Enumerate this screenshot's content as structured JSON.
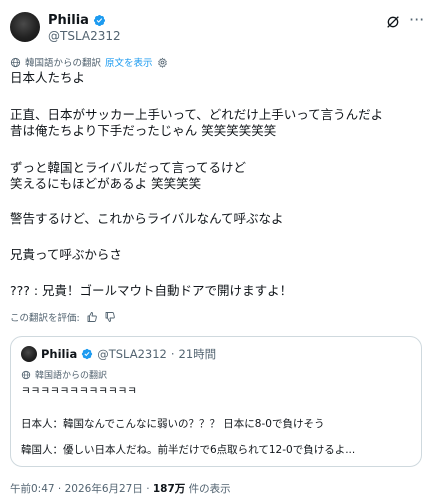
{
  "author": {
    "display_name": "Philia",
    "handle": "@TSLA2312"
  },
  "icons": {
    "verified": "verified-badge-icon",
    "grok": "grok-icon",
    "more": "more-options-icon",
    "globe": "globe-icon",
    "gear": "gear-icon",
    "thumb_up": "thumb-up-icon",
    "thumb_down": "thumb-down-icon"
  },
  "colors": {
    "accent": "#1d9bf0",
    "muted": "#536471",
    "text": "#0f1419",
    "border": "#cfd9de"
  },
  "translation_bar": {
    "label": "韓国語からの翻訳",
    "show_original": "原文を表示"
  },
  "post_lines": [
    "日本人たちよ",
    "正直、日本がサッカー上手いって、どれだけ上手いって言うんだよ",
    "昔は俺たちより下手だったじゃん 笑笑笑笑笑笑",
    "ずっと韓国とライバルだって言ってるけど",
    "笑えるにもほどがあるよ 笑笑笑笑",
    "警告するけど、これからライバルなんて呼ぶなよ",
    "兄貴って呼ぶからさ",
    "??? : 兄貴！ゴールマウト自動ドアで開けますよ！"
  ],
  "rate": {
    "label": "この翻訳を評価:"
  },
  "quote": {
    "display_name": "Philia",
    "handle": "@TSLA2312",
    "separator": "·",
    "time": "21時間",
    "translation_label": "韓国語からの翻訳",
    "lines": [
      "ㅋㅋㅋㅋㅋㅋㅋㅋㅋㅋㅋㅋ",
      "日本人：韓国なんでこんなに弱いの？？？ 日本に8-0で負けそう",
      "韓国人：優しい日本人だね。前半だけで6点取られて12-0で負けるよ..."
    ]
  },
  "footer": {
    "timestamp": "午前0:47 · 2026年6月27日 · ",
    "views": "187万",
    "views_suffix": " 件の表示"
  }
}
